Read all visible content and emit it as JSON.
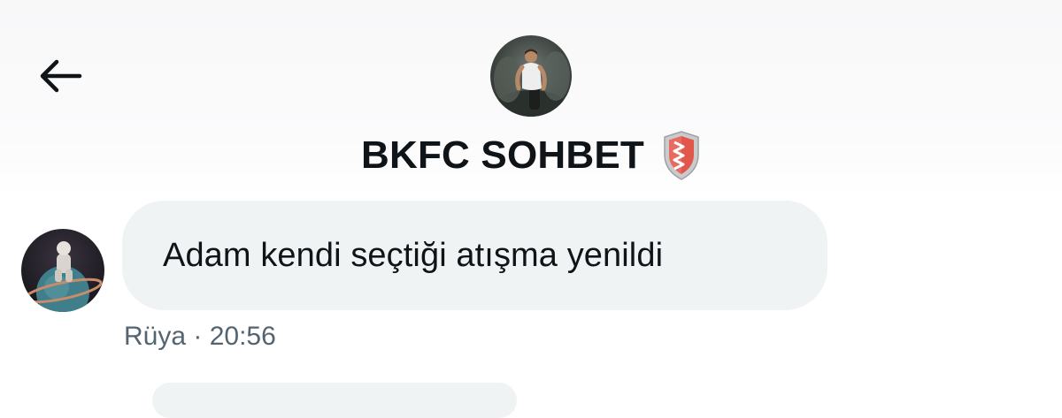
{
  "header": {
    "back_icon": "arrow-left-icon",
    "group_name": "BKFC SOHBET",
    "badge_icon": "shield-icon",
    "badge_colors": {
      "fill": "#e2574c",
      "stripe": "#ffffff",
      "rim": "#b9bcbe"
    }
  },
  "messages": [
    {
      "sender": "Rüya",
      "text": "Adam kendi seçtiği atışma yenildi",
      "meta": "Rüya · 20:56"
    }
  ],
  "colors": {
    "bubble_bg": "#eff3f4",
    "text_primary": "#0f1419",
    "text_secondary": "#536471"
  }
}
